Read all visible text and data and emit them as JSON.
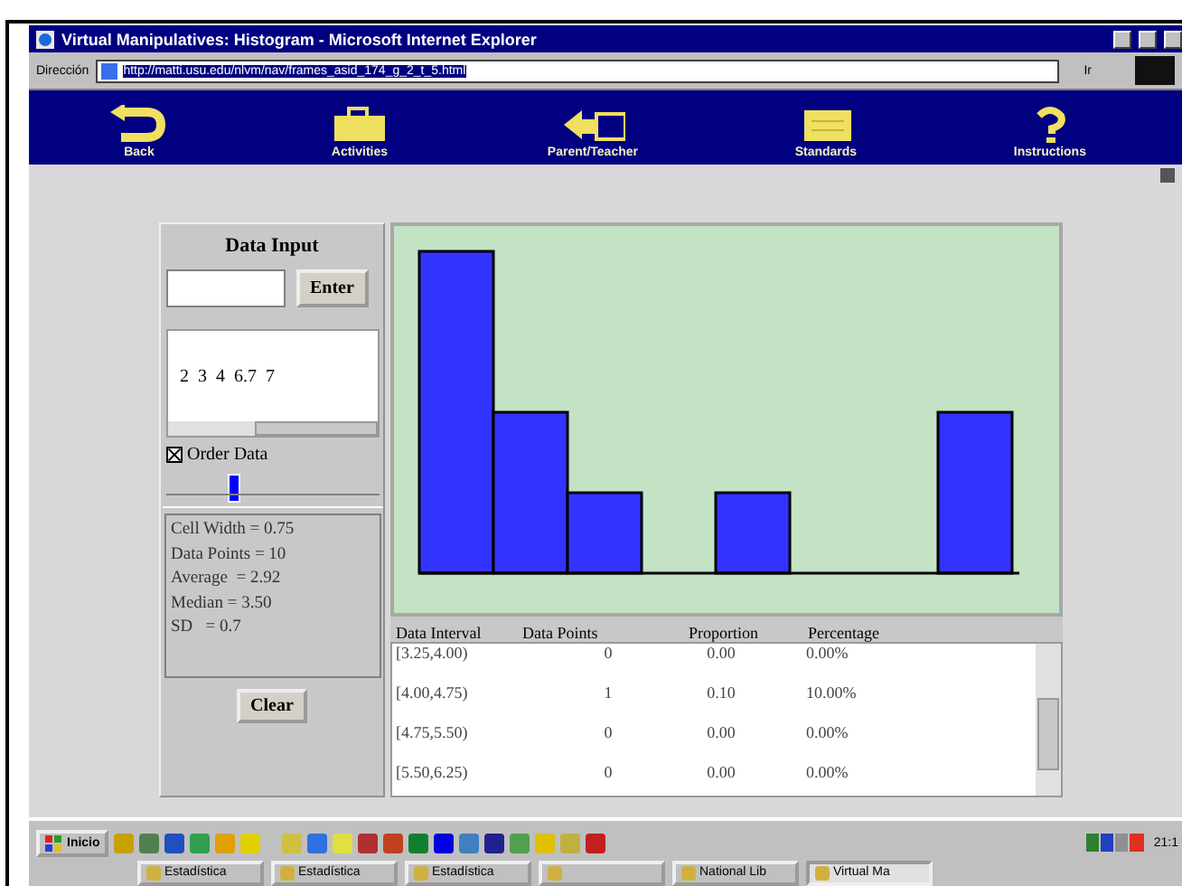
{
  "window": {
    "title": "Virtual Manipulatives: Histogram - Microsoft Internet Explorer"
  },
  "address_bar": {
    "label": "Dirección",
    "value": "http://matti.usu.edu/nlvm/nav/frames_asid_174_g_2_t_5.html",
    "go": "Ir"
  },
  "nav": [
    {
      "label": "Back",
      "kind": "back"
    },
    {
      "label": "Activities",
      "kind": "activities"
    },
    {
      "label": "Parent/Teacher",
      "kind": "parent"
    },
    {
      "label": "Standards",
      "kind": "standards"
    },
    {
      "label": "Instructions",
      "kind": "instructions"
    }
  ],
  "data_input": {
    "title": "Data Input",
    "enter": "Enter",
    "data": "2  3  4  6.7  7",
    "order_data": {
      "label": "Order Data",
      "checked": true
    },
    "cell_width_slider": {
      "level": 0.32
    },
    "stats": [
      "Cell Width = 0.75",
      "Data Points = 10",
      "Average  = 2.92",
      "Median = 3.50",
      "SD   = 0.7"
    ],
    "clear": "Clear"
  },
  "table": {
    "columns": [
      "Data Interval",
      "Data Points",
      "Proportion",
      "Percentage"
    ],
    "rows": [
      [
        "[3.25,4.00)",
        "0",
        "0.00",
        "0.00%"
      ],
      [
        "[4.00,4.75)",
        "1",
        "0.10",
        "10.00%"
      ],
      [
        "[4.75,5.50)",
        "0",
        "0.00",
        "0.00%"
      ],
      [
        "[5.50,6.25)",
        "0",
        "0.00",
        "0.00%"
      ]
    ]
  },
  "taskbar": {
    "start": "Inicio",
    "clock": "21:1",
    "tasks": [
      {
        "label": "Estadística",
        "selected": false
      },
      {
        "label": "Estadística",
        "selected": false
      },
      {
        "label": "Estadística",
        "selected": false
      },
      {
        "selected": false
      },
      {
        "label": "National Lib",
        "selected": false
      },
      {
        "label": "Virtual Ma",
        "selected": true
      }
    ]
  }
}
